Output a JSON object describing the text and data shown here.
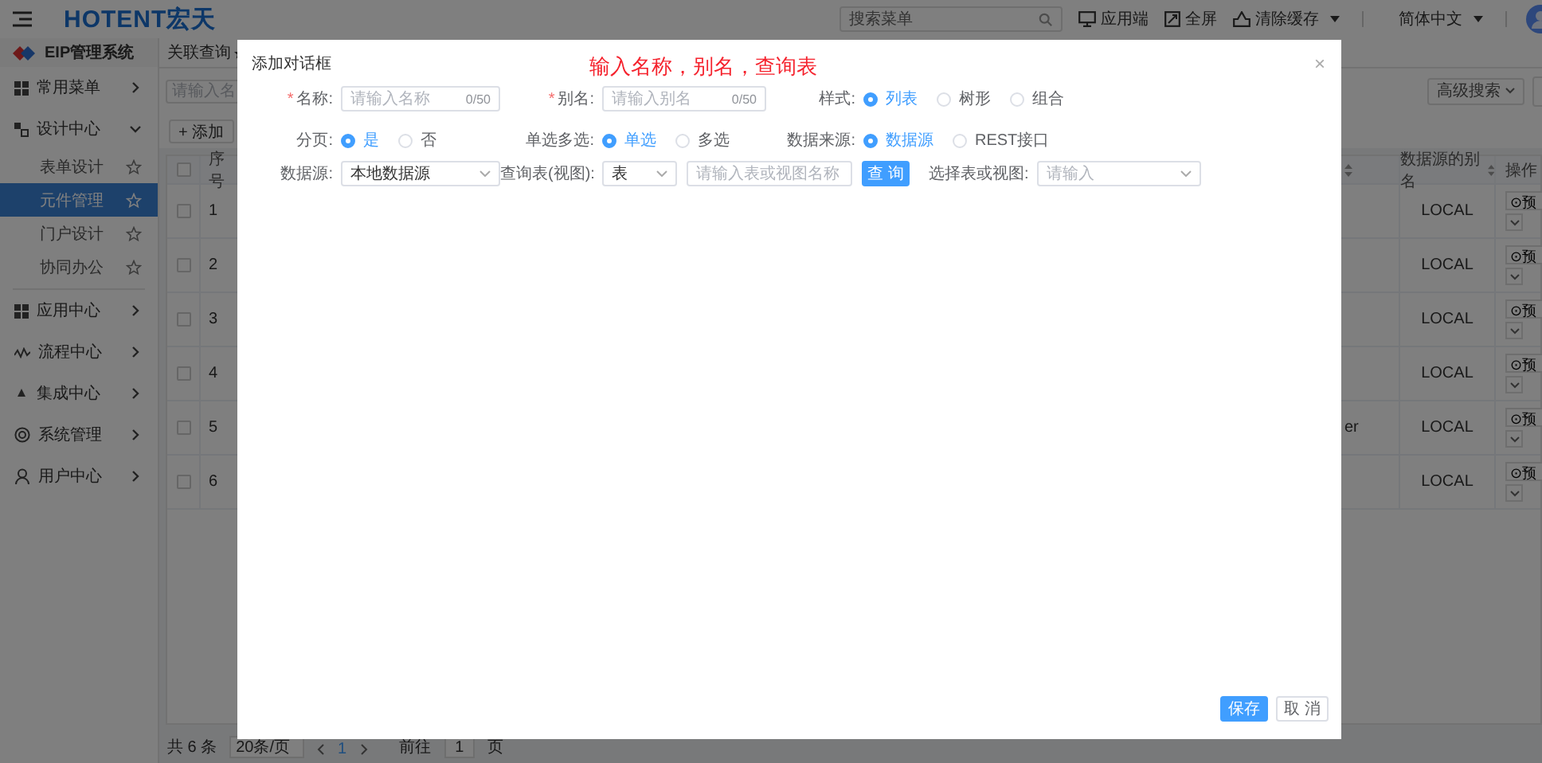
{
  "header": {
    "logo": "HOTENT宏天",
    "search": {
      "placeholder": "搜索菜单"
    },
    "actions": [
      {
        "label": "应用端",
        "kind": "plain"
      },
      {
        "label": "全屏",
        "kind": "plain"
      },
      {
        "label": "清除缓存",
        "kind": "dropdown"
      },
      {
        "label": "简体中文",
        "kind": "dropdown"
      }
    ]
  },
  "sidebar": {
    "title": "EIP管理系统",
    "items": [
      {
        "label": "常用菜单",
        "expanded": false
      },
      {
        "label": "设计中心",
        "expanded": true,
        "children": [
          {
            "label": "表单设计",
            "selected": false
          },
          {
            "label": "元件管理",
            "selected": true
          },
          {
            "label": "门户设计",
            "selected": false
          },
          {
            "label": "协同办公",
            "selected": false
          }
        ]
      },
      {
        "label": "应用中心",
        "expanded": false
      },
      {
        "label": "流程中心",
        "expanded": false
      },
      {
        "label": "集成中心",
        "expanded": false
      },
      {
        "label": "系统管理",
        "expanded": false
      },
      {
        "label": "用户中心",
        "expanded": false
      }
    ]
  },
  "tab": {
    "label": "关联查询"
  },
  "toolbar": {
    "search": {
      "placeholder": "请输入名"
    },
    "advanced_search": "高级搜索",
    "add": "+ 添加"
  },
  "table": {
    "all_checked": false,
    "columns": [
      {
        "label": "序号"
      },
      {
        "label": "数据源的别名"
      },
      {
        "label": "操作"
      }
    ],
    "rows": [
      {
        "checked": false,
        "number": "1",
        "alias": "LOCAL",
        "action": "⊙预"
      },
      {
        "checked": false,
        "number": "2",
        "alias": "LOCAL",
        "action": "⊙预"
      },
      {
        "checked": false,
        "number": "3",
        "alias": "LOCAL",
        "action": "⊙预"
      },
      {
        "checked": false,
        "number": "4",
        "alias": "LOCAL",
        "action": "⊙预"
      },
      {
        "checked": false,
        "number": "5",
        "column_3": "er",
        "alias": "LOCAL",
        "action": "⊙预"
      },
      {
        "checked": false,
        "number": "6",
        "alias": "LOCAL",
        "action": "⊙预"
      }
    ]
  },
  "pagination": {
    "total": "共 6 条",
    "page_size": "20条/页",
    "current": "1",
    "goto_label": "前往",
    "goto_value": "1",
    "page_suffix": "页"
  },
  "dialog": {
    "title": "添加对话框",
    "annotation": "输入名称，别名，查询表",
    "close": "×",
    "rows": [
      [
        {
          "kind": "input",
          "mark": "*",
          "label": "名称:",
          "placeholder": "请输入名称",
          "counter": "0/50"
        },
        {
          "kind": "input",
          "mark": "*",
          "label": "别名:",
          "placeholder": "请输入别名",
          "counter": "0/50"
        },
        {
          "kind": "radio",
          "label": "样式:",
          "options": [
            {
              "label": "列表",
              "selected": true
            },
            {
              "label": "树形",
              "selected": false
            },
            {
              "label": "组合",
              "selected": false
            }
          ]
        }
      ],
      [
        {
          "kind": "radio",
          "label": "分页:",
          "options": [
            {
              "label": "是",
              "selected": true
            },
            {
              "label": "否",
              "selected": false
            }
          ]
        },
        {
          "kind": "radio",
          "label": "单选多选:",
          "options": [
            {
              "label": "单选",
              "selected": true
            },
            {
              "label": "多选",
              "selected": false
            }
          ]
        },
        {
          "kind": "radio",
          "label": "数据来源:",
          "options": [
            {
              "label": "数据源",
              "selected": true
            },
            {
              "label": "REST接口",
              "selected": false
            }
          ]
        }
      ],
      [
        {
          "kind": "select",
          "label": "数据源:",
          "value": "本地数据源"
        },
        {
          "kind": "query",
          "label": "查询表(视图):",
          "value": "表",
          "placeholder": "请输入表或视图名称",
          "button": "查 询"
        },
        {
          "kind": "select",
          "label": "选择表或视图:",
          "placeholder": "请输入"
        }
      ]
    ],
    "buttons": [
      {
        "label": "保存",
        "kind": "primary"
      },
      {
        "label": "取 消",
        "kind": "default"
      }
    ]
  }
}
